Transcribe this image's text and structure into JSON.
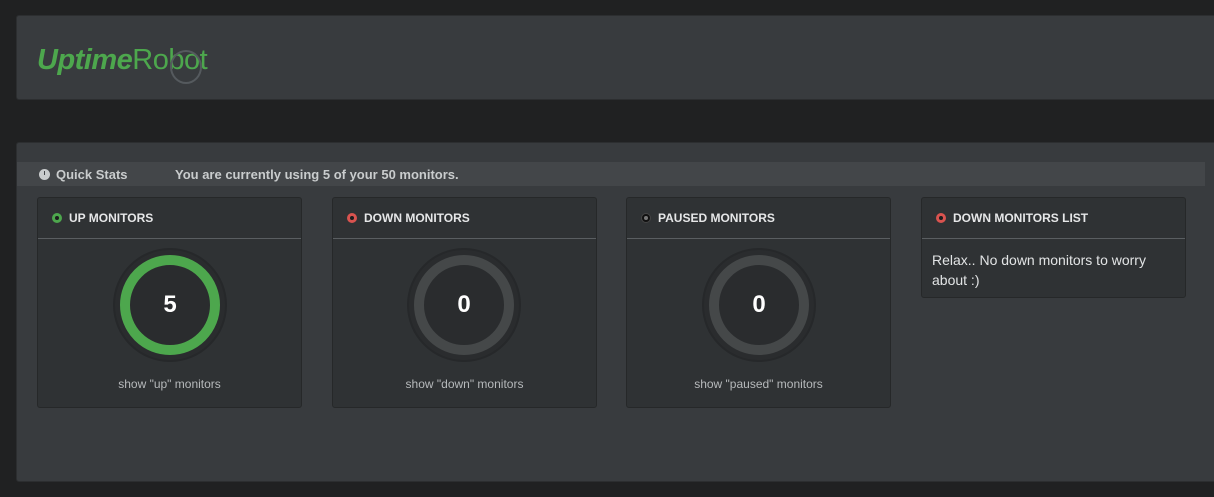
{
  "header": {
    "logo_bold": "Uptime",
    "logo_light": "Robot"
  },
  "stats": {
    "title": "Quick Stats",
    "usage": "You are currently using 5 of your 50 monitors."
  },
  "cards": {
    "up": {
      "title": "UP MONITORS",
      "count": "5",
      "link": "show \"up\" monitors"
    },
    "down": {
      "title": "DOWN MONITORS",
      "count": "0",
      "link": "show \"down\" monitors"
    },
    "paused": {
      "title": "PAUSED MONITORS",
      "count": "0",
      "link": "show \"paused\" monitors"
    },
    "list": {
      "title": "DOWN MONITORS LIST",
      "message": "Relax.. No down monitors to worry about :)"
    }
  },
  "colors": {
    "up": "#4da74d",
    "down": "#d9534f",
    "paused": "#111111"
  }
}
